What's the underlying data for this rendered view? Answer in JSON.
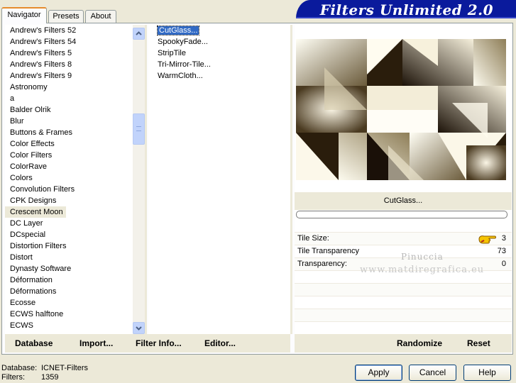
{
  "tabs": [
    {
      "label": "Navigator",
      "active": true
    },
    {
      "label": "Presets",
      "active": false
    },
    {
      "label": "About",
      "active": false
    }
  ],
  "header": {
    "title": "Filters Unlimited 2.0"
  },
  "categories": {
    "items": [
      "Andrew's Filters 52",
      "Andrew's Filters 54",
      "Andrew's Filters 5",
      "Andrew's Filters 8",
      "Andrew's Filters 9",
      "Astronomy",
      "a",
      "Balder Olrik",
      "Blur",
      "Buttons & Frames",
      "Color Effects",
      "Color Filters",
      "ColorRave",
      "Colors",
      "Convolution Filters",
      "CPK Designs",
      "Crescent Moon",
      "DC Layer",
      "DCspecial",
      "Distortion Filters",
      "Distort",
      "Dynasty Software",
      "Déformation",
      "Déformations",
      "Ecosse",
      "ECWS halftone",
      "ECWS"
    ],
    "selected": "Crescent Moon"
  },
  "filters": {
    "items": [
      "CutGlass...",
      "SpookyFade...",
      "StripTile",
      "Tri-Mirror-Tile...",
      "WarmCloth..."
    ],
    "selected": "CutGlass..."
  },
  "preview": {
    "filter_name": "CutGlass..."
  },
  "params": [
    {
      "label": "Tile Size:",
      "value": "3"
    },
    {
      "label": "Tile Transparency",
      "value": "73"
    },
    {
      "label": "Transparency:",
      "value": "0"
    }
  ],
  "watermark": {
    "line1": "Pinuccia",
    "line2": "www.matdiregrafica.eu"
  },
  "left_toolbar": {
    "database": "Database",
    "import": "Import...",
    "filter_info": "Filter Info...",
    "editor": "Editor..."
  },
  "right_toolbar": {
    "randomize": "Randomize",
    "reset": "Reset"
  },
  "status": {
    "database_label": "Database:",
    "database_value": "ICNET-Filters",
    "filters_label": "Filters:",
    "filters_value": "1359"
  },
  "buttons": {
    "apply": "Apply",
    "cancel": "Cancel",
    "help": "Help"
  },
  "colors": {
    "header_blue": "#0a1a9c",
    "selection_blue": "#316ac5",
    "face": "#ece9d8"
  }
}
